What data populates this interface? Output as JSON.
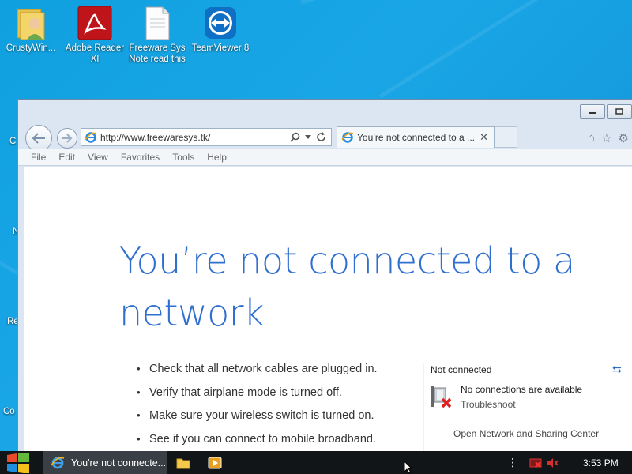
{
  "desktop": {
    "icons": [
      {
        "name": "crustywin-folder",
        "label": "CrustyWin..."
      },
      {
        "name": "adobe-reader",
        "label": "Adobe Reader XI"
      },
      {
        "name": "freeware-note",
        "label": "Freeware Sys Note read this"
      },
      {
        "name": "teamviewer",
        "label": "TeamViewer 8"
      }
    ],
    "edge_labels": [
      "C",
      "N",
      "Re",
      "Co"
    ]
  },
  "browser": {
    "url": "http://www.freewaresys.tk/",
    "tab_title": "You’re not connected to a ...",
    "menu": [
      "File",
      "Edit",
      "View",
      "Favorites",
      "Tools",
      "Help"
    ]
  },
  "page": {
    "heading_line1": "You’re not connected to a",
    "heading_line2": "network",
    "tips": [
      "Check that all network cables are plugged in.",
      "Verify that airplane mode is turned off.",
      "Make sure your wireless switch is turned on.",
      "See if you can connect to mobile broadband."
    ],
    "network_panel": {
      "header": "Not connected",
      "status": "No connections are available",
      "troubleshoot": "Troubleshoot",
      "open_center": "Open Network and Sharing Center"
    }
  },
  "taskbar": {
    "active_item": "You're not connecte...",
    "clock": "3:53 PM"
  },
  "colors": {
    "desktop_bg": "#1aa6e6",
    "heading_blue": "#2e6fd0",
    "taskbar": "#121518"
  }
}
